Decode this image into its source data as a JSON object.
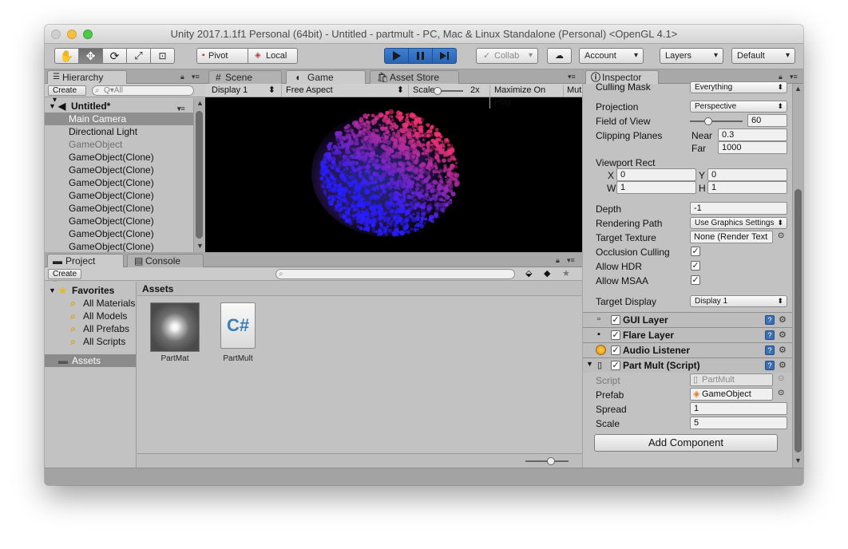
{
  "window": {
    "title": "Unity 2017.1.1f1 Personal (64bit) - Untitled - partmult - PC, Mac & Linux Standalone (Personal) <OpenGL 4.1>"
  },
  "toolbar": {
    "pivot": "Pivot",
    "local": "Local",
    "collab": "Collab",
    "account": "Account",
    "layers": "Layers",
    "layout": "Default"
  },
  "hierarchy": {
    "tab": "Hierarchy",
    "create": "Create",
    "search_placeholder": "Q▾All",
    "scene_name": "Untitled*",
    "items": [
      {
        "label": "Main Camera",
        "selected": true,
        "disabled": false
      },
      {
        "label": "Directional Light",
        "selected": false,
        "disabled": false
      },
      {
        "label": "GameObject",
        "selected": false,
        "disabled": true
      },
      {
        "label": "GameObject(Clone)",
        "selected": false,
        "disabled": false
      },
      {
        "label": "GameObject(Clone)",
        "selected": false,
        "disabled": false
      },
      {
        "label": "GameObject(Clone)",
        "selected": false,
        "disabled": false
      },
      {
        "label": "GameObject(Clone)",
        "selected": false,
        "disabled": false
      },
      {
        "label": "GameObject(Clone)",
        "selected": false,
        "disabled": false
      },
      {
        "label": "GameObject(Clone)",
        "selected": false,
        "disabled": false
      },
      {
        "label": "GameObject(Clone)",
        "selected": false,
        "disabled": false
      },
      {
        "label": "GameObject(Clone)",
        "selected": false,
        "disabled": false
      }
    ]
  },
  "game": {
    "tabs": {
      "scene": "Scene",
      "game": "Game",
      "asset_store": "Asset Store"
    },
    "display": "Display 1",
    "aspect": "Free Aspect",
    "scale_label": "Scale",
    "scale_value": "2x",
    "scale_fraction": 0.1,
    "maximize": "Maximize On Play",
    "mute": "Mut"
  },
  "project": {
    "tabs": {
      "project": "Project",
      "console": "Console"
    },
    "create": "Create",
    "favorites_label": "Favorites",
    "favorites": [
      "All Materials",
      "All Models",
      "All Prefabs",
      "All Scripts"
    ],
    "assets_folder": "Assets",
    "assets_header": "Assets",
    "assets": [
      {
        "name": "PartMat",
        "icon": "material-thumbnail-icon"
      },
      {
        "name": "PartMult",
        "icon": "csharp-script-icon"
      }
    ],
    "zoom_fraction": 0.6
  },
  "inspector": {
    "tab": "Inspector",
    "camera": {
      "culling_mask_label": "Culling Mask",
      "culling_mask_value": "Everything",
      "projection_label": "Projection",
      "projection_value": "Perspective",
      "fov_label": "Field of View",
      "fov_value": "60",
      "fov_fraction": 0.35,
      "clipping_label": "Clipping Planes",
      "near_label": "Near",
      "near_value": "0.3",
      "far_label": "Far",
      "far_value": "1000",
      "viewport_label": "Viewport Rect",
      "x_label": "X",
      "x_value": "0",
      "y_label": "Y",
      "y_value": "0",
      "w_label": "W",
      "w_value": "1",
      "h_label": "H",
      "h_value": "1",
      "depth_label": "Depth",
      "depth_value": "-1",
      "rendering_path_label": "Rendering Path",
      "rendering_path_value": "Use Graphics Settings",
      "target_texture_label": "Target Texture",
      "target_texture_value": "None (Render Text",
      "occlusion_label": "Occlusion Culling",
      "hdr_label": "Allow HDR",
      "msaa_label": "Allow MSAA",
      "target_display_label": "Target Display",
      "target_display_value": "Display 1"
    },
    "components": {
      "gui_layer": "GUI Layer",
      "flare_layer": "Flare Layer",
      "audio_listener": "Audio Listener",
      "part_mult": "Part Mult (Script)"
    },
    "script": {
      "script_label": "Script",
      "script_value": "PartMult",
      "prefab_label": "Prefab",
      "prefab_value": "GameObject",
      "spread_label": "Spread",
      "spread_value": "1",
      "scale_label": "Scale",
      "scale_value": "5"
    },
    "add_component": "Add Component"
  }
}
